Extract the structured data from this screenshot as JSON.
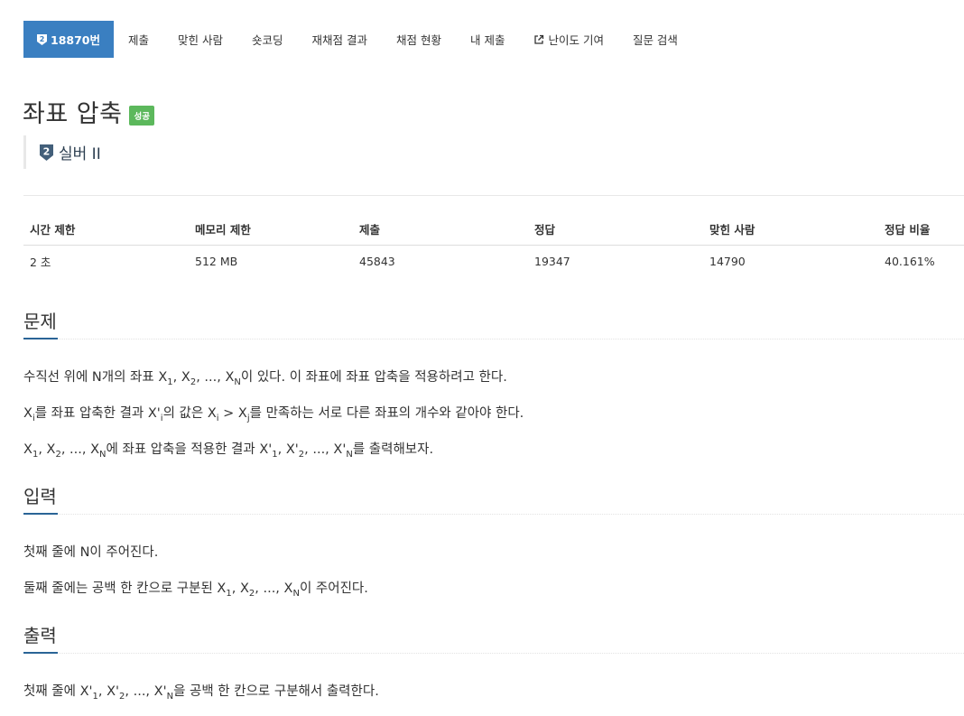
{
  "tabs": [
    {
      "label": "18870번",
      "active": true,
      "icon": "silver-tier-badge-icon"
    },
    {
      "label": "제출"
    },
    {
      "label": "맞힌 사람"
    },
    {
      "label": "숏코딩"
    },
    {
      "label": "재채점 결과"
    },
    {
      "label": "채점 현황"
    },
    {
      "label": "내 제출"
    },
    {
      "label": "난이도 기여",
      "icon": "external-link-icon"
    },
    {
      "label": "질문 검색"
    }
  ],
  "problem": {
    "title": "좌표 압축",
    "status_badge": "성공",
    "tier": "실버 II",
    "tier_icon": "silver-2-badge-icon"
  },
  "info_table": {
    "headers": [
      "시간 제한",
      "메모리 제한",
      "제출",
      "정답",
      "맞힌 사람",
      "정답 비율"
    ],
    "values": [
      "2 초",
      "512 MB",
      "45843",
      "19347",
      "14790",
      "40.161%"
    ]
  },
  "sections": {
    "problem": {
      "title": "문제",
      "p1": {
        "a": "수직선 위에 N개의 좌표 X",
        "s1": "1",
        "b": ", X",
        "s2": "2",
        "c": ", ..., X",
        "s3": "N",
        "d": "이 있다. 이 좌표에 좌표 압축을 적용하려고 한다."
      },
      "p2": {
        "a": "X",
        "s1": "i",
        "b": "를 좌표 압축한 결과 X'",
        "s2": "i",
        "c": "의 값은 X",
        "s3": "i",
        "d": " > X",
        "s4": "j",
        "e": "를 만족하는 서로 다른 좌표의 개수와 같아야 한다."
      },
      "p3": {
        "a": "X",
        "s1": "1",
        "b": ", X",
        "s2": "2",
        "c": ", ..., X",
        "s3": "N",
        "d": "에 좌표 압축을 적용한 결과 X'",
        "s4": "1",
        "e": ", X'",
        "s5": "2",
        "f": ", ..., X'",
        "s6": "N",
        "g": "를 출력해보자."
      }
    },
    "input": {
      "title": "입력",
      "p1": "첫째 줄에 N이 주어진다.",
      "p2": {
        "a": "둘째 줄에는 공백 한 칸으로 구분된 X",
        "s1": "1",
        "b": ", X",
        "s2": "2",
        "c": ", ..., X",
        "s3": "N",
        "d": "이 주어진다."
      }
    },
    "output": {
      "title": "출력",
      "p1": {
        "a": "첫째 줄에 X'",
        "s1": "1",
        "b": ", X'",
        "s2": "2",
        "c": ", ..., X'",
        "s3": "N",
        "d": "을 공백 한 칸으로 구분해서 출력한다."
      }
    }
  },
  "colors": {
    "active_tab": "#3a7fc1",
    "success_badge": "#5cb85c",
    "section_accent": "#2a6496",
    "tier_silver": "#435f7a"
  }
}
